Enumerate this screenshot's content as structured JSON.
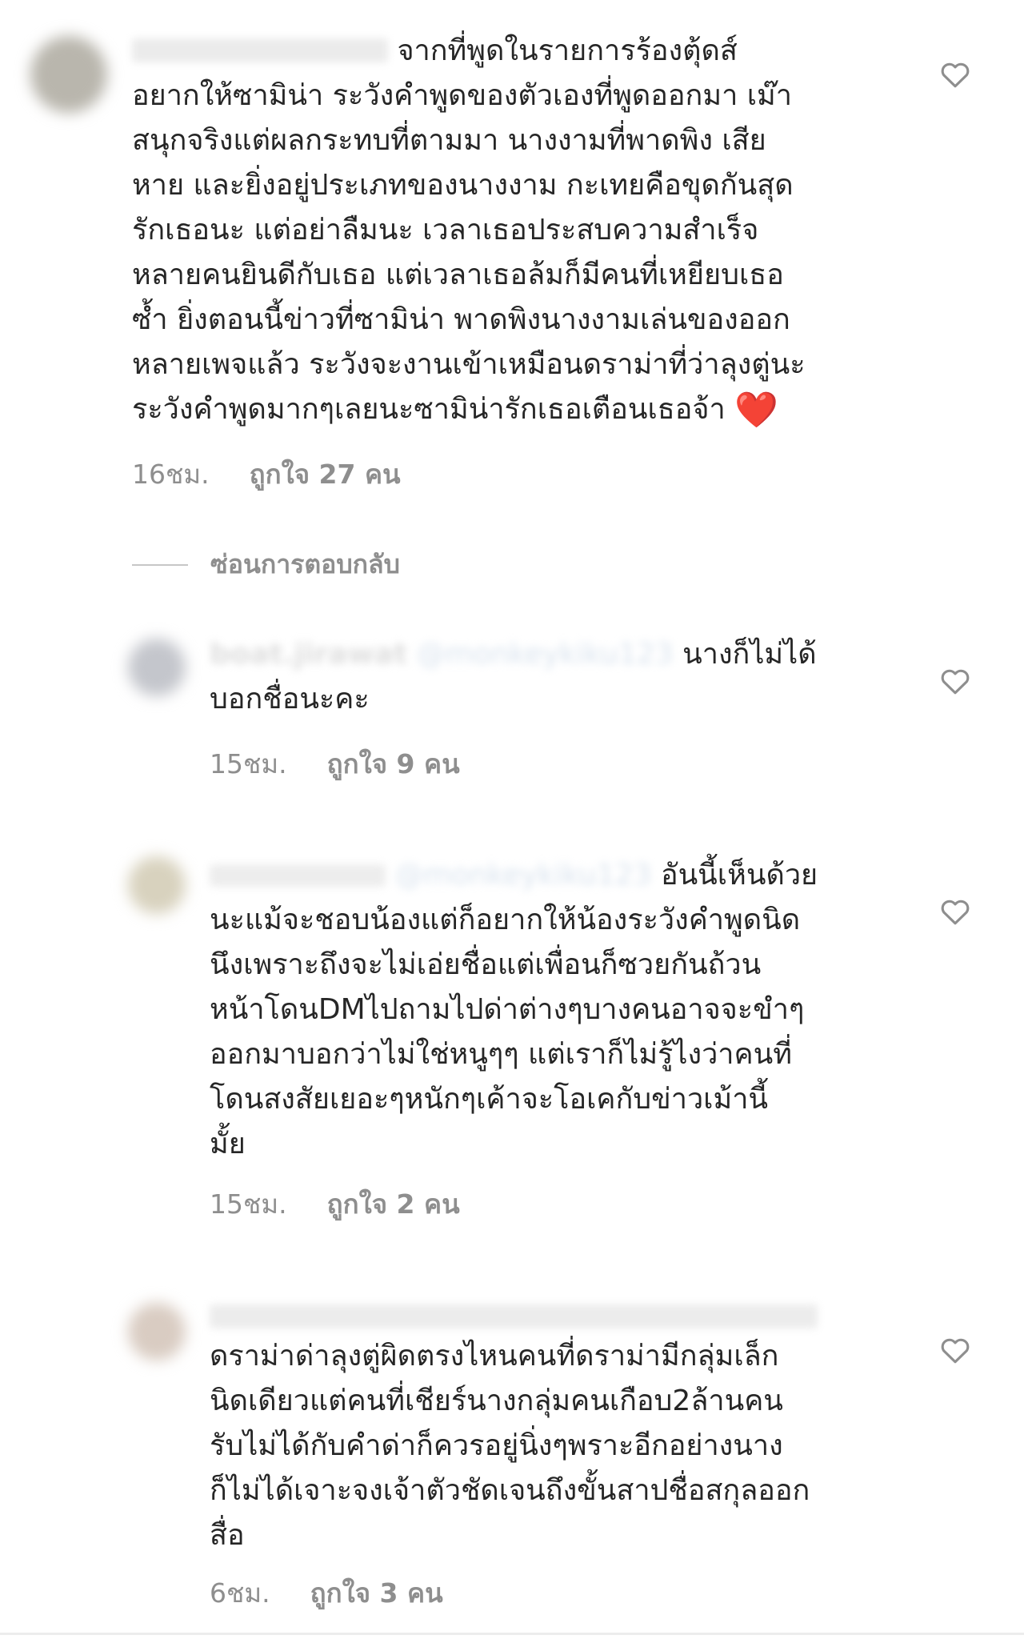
{
  "colors": {
    "text": "#262626",
    "secondary_text": "#8e8e8e",
    "heart_outline": "#8e8e8e",
    "emoji_heart": "#e0242c"
  },
  "comments": [
    {
      "username": "",
      "mention": "",
      "lines": [
        "จากที่พูดในรายการร้องตุ้ดส์",
        "อยากให้ซามิน่า ระวังคำพูดของตัวเองที่พูดออกมา เม๊า",
        "สนุกจริงแต่ผลกระทบที่ตามมา นางงามที่พาดพิง เสีย",
        "หาย และยิ่งอยู่ประเภทของนางงาม กะเทยคือขุดกันสุด",
        "รักเธอนะ แต่อย่าลืมนะ เวลาเธอประสบความสำเร็จ",
        "หลายคนยินดีกับเธอ แต่เวลาเธอล้มก็มีคนที่เหยียบเธอ",
        "ซ้ำ ยิ่งตอนนี้ข่าวที่ซามิน่า พาดพิงนางงามเล่นของออก",
        "หลายเพจแล้ว ระวังจะงานเข้าเหมือนดราม่าที่ว่าลุงตู่นะ",
        "ระวังคำพูดมากๆเลยนะซามิน่ารักเธอเตือนเธอจ้า"
      ],
      "emoji": "❤️",
      "icon": "heart-outline-icon",
      "time": "16ชม.",
      "likes": "ถูกใจ 27 คน"
    },
    {
      "username": "boat.jirawat",
      "mention": "@monkeykiku123",
      "lines": [
        "นางก็ไม่ได้",
        "บอกชื่อนะคะ"
      ],
      "icon": "heart-outline-icon",
      "time": "15ชม.",
      "likes": "ถูกใจ 9 คน"
    },
    {
      "username": "",
      "mention": "@monkeykiku123",
      "lines": [
        "อันนี้เห็นด้วย",
        "นะแม้จะชอบน้องแต่ก็อยากให้น้องระวังคำพูดนิด",
        "นึงเพราะถึงจะไม่เอ่ยชื่อแต่เพื่อนก็ซวยกันถ้วน",
        "หน้าโดนDMไปถามไปด่าต่างๆบางคนอาจจะขำๆ",
        "ออกมาบอกว่าไม่ใช่หนูๆๆ แต่เราก็ไม่รู้ไงว่าคนที่",
        "โดนสงสัยเยอะๆหนักๆเค้าจะโอเคกับข่าวเม้านี้",
        "มั้ย"
      ],
      "icon": "heart-outline-icon",
      "time": "15ชม.",
      "likes": "ถูกใจ 2 คน"
    },
    {
      "username": "",
      "mention": "",
      "lines": [
        "ดราม่าด่าลุงตู่ผิดตรงไหนคนที่ดราม่ามีกลุ่มเล็ก",
        "นิดเดียวแต่คนที่เชียร์นางกลุ่มคนเกือบ2ล้านคน",
        "รับไม่ได้กับคำด่าก็ควรอยู่นิ่งๆพราะอีกอย่างนาง",
        "ก็ไม่ได้เจาะจงเจ้าตัวชัดเจนถึงขั้นสาปชื่อสกุลออก",
        "สื่อ"
      ],
      "icon": "heart-outline-icon",
      "time": "6ชม.",
      "likes": "ถูกใจ 3 คน"
    }
  ],
  "replies_toggle": {
    "label": "ซ่อนการตอบกลับ"
  }
}
